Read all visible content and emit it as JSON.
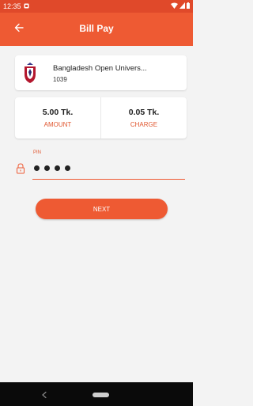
{
  "status_bar": {
    "time": "12:35",
    "icons": [
      "notification-icon",
      "wifi-icon",
      "signal-icon",
      "battery-icon"
    ]
  },
  "app_bar": {
    "title": "Bill Pay",
    "back_icon": "arrow-left-icon"
  },
  "merchant": {
    "name": "Bangladesh Open Univers...",
    "code": "1039",
    "logo": "university-crest-logo"
  },
  "payment": {
    "amount_value": "5.00 Tk.",
    "amount_label": "AMOUNT",
    "charge_value": "0.05 Tk.",
    "charge_label": "CHARGE"
  },
  "pin": {
    "label": "PIN",
    "masked_value": "••••",
    "length": 4,
    "icon": "lock-icon"
  },
  "actions": {
    "next_label": "NEXT"
  },
  "colors": {
    "status_bar": "#e0492a",
    "primary": "#ee5a33",
    "accent_text": "#e0562f",
    "background": "#f3f3f3",
    "nav_bar": "#0a0a0a"
  }
}
